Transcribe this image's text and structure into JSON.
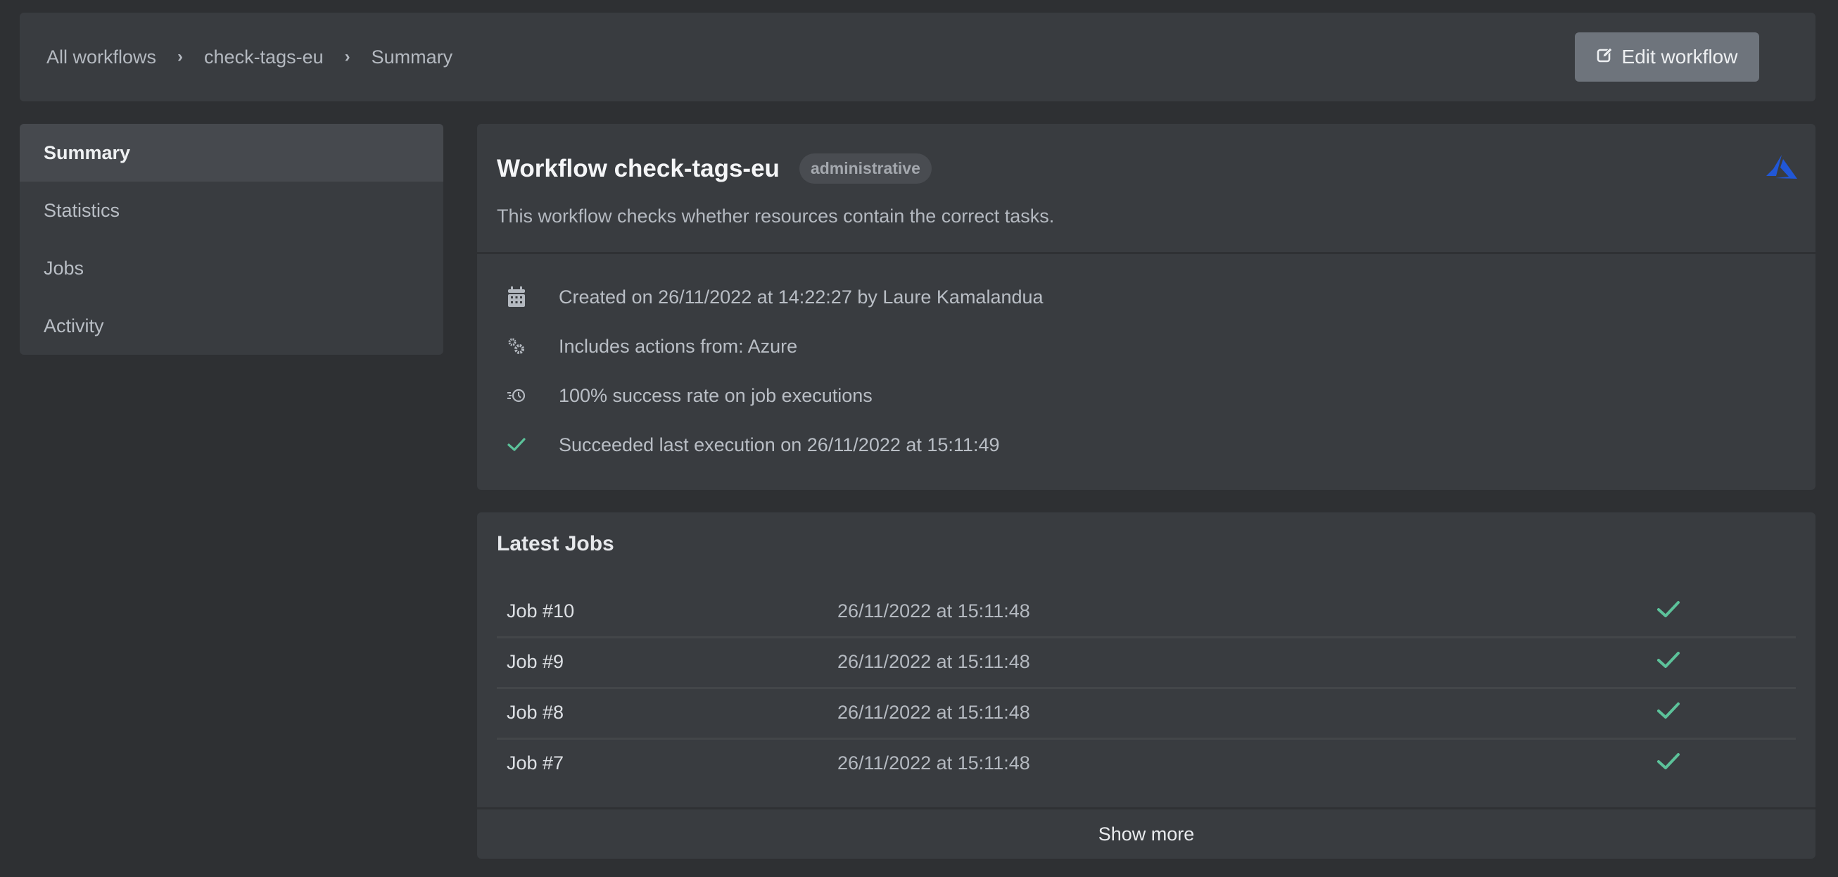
{
  "breadcrumb": {
    "items": [
      "All workflows",
      "check-tags-eu",
      "Summary"
    ]
  },
  "header": {
    "edit_label": "Edit workflow",
    "edit_icon": "edit-icon"
  },
  "sidebar": {
    "items": [
      {
        "label": "Summary",
        "active": true
      },
      {
        "label": "Statistics",
        "active": false
      },
      {
        "label": "Jobs",
        "active": false
      },
      {
        "label": "Activity",
        "active": false
      }
    ]
  },
  "summary": {
    "title": "Workflow check-tags-eu",
    "badge": "administrative",
    "provider_icon": "azure-logo-icon",
    "description": "This workflow checks whether resources contain the correct tasks.",
    "details": [
      {
        "icon": "calendar-icon",
        "text": "Created on 26/11/2022 at 14:22:27 by Laure Kamalandua"
      },
      {
        "icon": "gears-icon",
        "text": "Includes actions from: Azure"
      },
      {
        "icon": "history-icon",
        "text": "100% success rate on job executions"
      },
      {
        "icon": "check-icon",
        "text": "Succeeded last execution on 26/11/2022 at 15:11:49"
      }
    ]
  },
  "jobs": {
    "title": "Latest Jobs",
    "rows": [
      {
        "name": "Job #10",
        "date": "26/11/2022 at 15:11:48",
        "status": "success"
      },
      {
        "name": "Job #9",
        "date": "26/11/2022 at 15:11:48",
        "status": "success"
      },
      {
        "name": "Job #8",
        "date": "26/11/2022 at 15:11:48",
        "status": "success"
      },
      {
        "name": "Job #7",
        "date": "26/11/2022 at 15:11:48",
        "status": "success"
      }
    ],
    "show_more_label": "Show more"
  },
  "colors": {
    "success": "#5cc29a",
    "azure": "#2157d6",
    "background": "#2e3033",
    "panel": "#393c40"
  }
}
